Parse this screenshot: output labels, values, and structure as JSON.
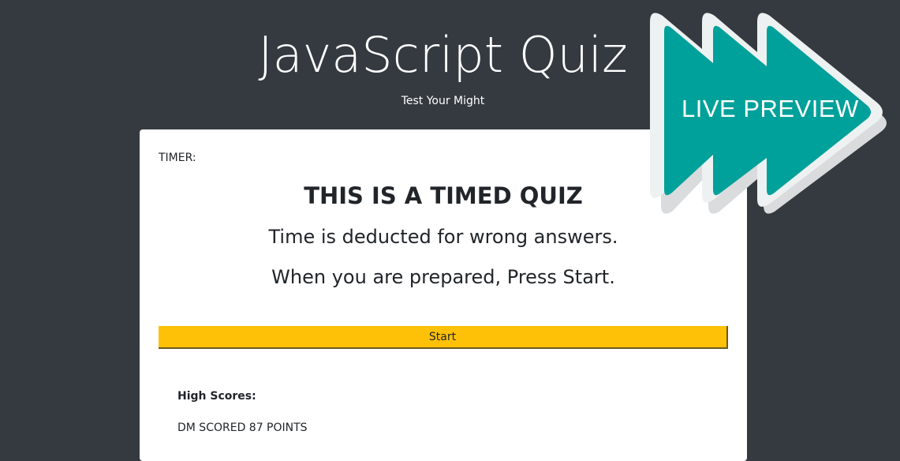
{
  "header": {
    "title": "JavaScript Quiz",
    "subtitle": "Test Your Might"
  },
  "quiz": {
    "timer_label": "TIMER:",
    "heading": "THIS IS A TIMED QUIZ",
    "rules": [
      "Time is deducted for wrong answers.",
      "When you are prepared, Press Start."
    ],
    "start_label": "Start"
  },
  "highscores": {
    "title": "High Scores:",
    "entries": [
      "DM SCORED 87 POINTS"
    ]
  },
  "badge": {
    "text": "LIVE PREVIEW",
    "icon": "fast-forward-icon"
  },
  "colors": {
    "background": "#343a40",
    "card": "#ffffff",
    "accent": "#ffc107",
    "badge": "#00a19a"
  }
}
